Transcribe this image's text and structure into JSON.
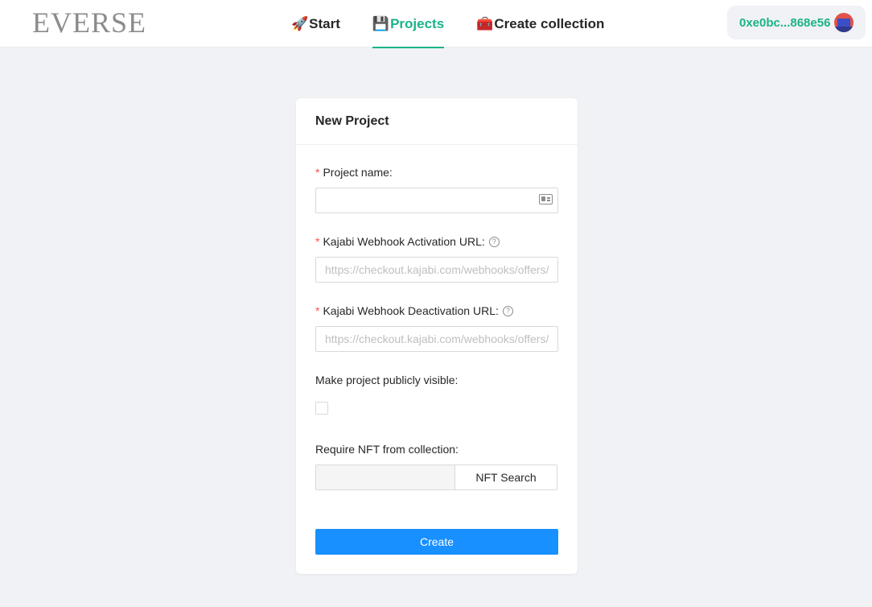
{
  "header": {
    "logo": "EVERSE",
    "nav": [
      {
        "emoji": "🚀",
        "label": "Start"
      },
      {
        "emoji": "💾",
        "label": "Projects"
      },
      {
        "emoji": "🧰",
        "label": "Create collection"
      }
    ],
    "active_nav": "Projects",
    "wallet_address": "0xe0bc...868e56"
  },
  "form": {
    "title": "New Project",
    "project_name_label": "Project name:",
    "project_name_value": "",
    "activation_label": "Kajabi Webhook Activation URL:",
    "activation_placeholder": "https://checkout.kajabi.com/webhooks/offers/...",
    "deactivation_label": "Kajabi Webhook Deactivation URL:",
    "deactivation_placeholder": "https://checkout.kajabi.com/webhooks/offers/...",
    "public_label": "Make project publicly visible:",
    "public_checked": false,
    "nft_label": "Require NFT from collection:",
    "nft_button": "NFT Search",
    "create_button": "Create",
    "required_mark": "*",
    "help_mark": "?"
  },
  "colors": {
    "accent": "#1bb387",
    "primary": "#1890ff",
    "required": "#ff4d4f",
    "background": "#f0f2f5"
  },
  "icons": [
    "contact-card-icon",
    "question-circle-icon",
    "rocket-icon",
    "floppy-disk-icon",
    "toolbox-icon"
  ]
}
